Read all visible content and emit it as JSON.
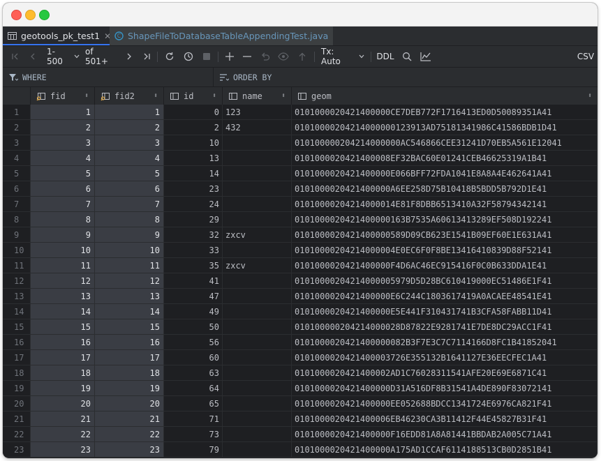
{
  "tabs": [
    {
      "label": "geotools_pk_test1",
      "active": true
    },
    {
      "label": "ShapeFileToDatabaseTableAppendingTest.java",
      "active": false
    }
  ],
  "toolbar": {
    "range": "1-500",
    "total": "of 501+",
    "tx": "Tx: Auto",
    "ddl": "DDL",
    "csv": "CSV"
  },
  "filter": {
    "where": "WHERE",
    "order_by": "ORDER BY"
  },
  "columns": [
    {
      "key": "fid",
      "label": "fid",
      "icon": "key-column-icon"
    },
    {
      "key": "fid2",
      "label": "fid2",
      "icon": "key-column-icon"
    },
    {
      "key": "id",
      "label": "id",
      "icon": "column-icon"
    },
    {
      "key": "name",
      "label": "name",
      "icon": "column-icon"
    },
    {
      "key": "geom",
      "label": "geom",
      "icon": "column-icon"
    }
  ],
  "rows": [
    {
      "n": "1",
      "fid": "1",
      "fid2": "1",
      "id": "0",
      "name": "123",
      "geom": "0101000020421400000CE7DEB772F1716413ED0D50089351A41"
    },
    {
      "n": "2",
      "fid": "2",
      "fid2": "2",
      "id": "2",
      "name": "432",
      "geom": "01010000204214000000123913AD75181341986C41586BDB1D41"
    },
    {
      "n": "3",
      "fid": "3",
      "fid2": "3",
      "id": "10",
      "name": "",
      "geom": "010100000204214000000AC546866CEE31241D70EB5A561E12041"
    },
    {
      "n": "4",
      "fid": "4",
      "fid2": "4",
      "id": "13",
      "name": "",
      "geom": "0101000020421400008EF32BAC60E01241CEB46625319A1B41"
    },
    {
      "n": "5",
      "fid": "5",
      "fid2": "5",
      "id": "14",
      "name": "",
      "geom": "0101000020421400000E066BFF72FDA1041E8A8A4E462641A41"
    },
    {
      "n": "6",
      "fid": "6",
      "fid2": "6",
      "id": "23",
      "name": "",
      "geom": "0101000020421400000A6EE258D75B10418B5BDD5B792D1E41"
    },
    {
      "n": "7",
      "fid": "7",
      "fid2": "7",
      "id": "24",
      "name": "",
      "geom": "01010000204214000014E81F8DBB6513410A32F58794342141"
    },
    {
      "n": "8",
      "fid": "8",
      "fid2": "8",
      "id": "29",
      "name": "",
      "geom": "0101000020421400000163B7535A60613413289EF508D192241"
    },
    {
      "n": "9",
      "fid": "9",
      "fid2": "9",
      "id": "32",
      "name": "zxcv",
      "geom": "0101000020421400000589D09CB623E1541B09EF60E1E631A41"
    },
    {
      "n": "10",
      "fid": "10",
      "fid2": "10",
      "id": "33",
      "name": "",
      "geom": "01010000204214000004E0EC6F0F8BE13416410839D88F52141"
    },
    {
      "n": "11",
      "fid": "11",
      "fid2": "11",
      "id": "35",
      "name": "zxcv",
      "geom": "0101000020421400000F4D6AC46EC915416F0C0B633DDA1E41"
    },
    {
      "n": "12",
      "fid": "12",
      "fid2": "12",
      "id": "41",
      "name": "",
      "geom": "01010000204214000005979D5D28BC610419000EC51486E1F41"
    },
    {
      "n": "13",
      "fid": "13",
      "fid2": "13",
      "id": "47",
      "name": "",
      "geom": "0101000020421400000E6C244C1803617419A0ACAEE48541E41"
    },
    {
      "n": "14",
      "fid": "14",
      "fid2": "14",
      "id": "49",
      "name": "",
      "geom": "0101000020421400000E5E441F310431741B3CFA58FABB11D41"
    },
    {
      "n": "15",
      "fid": "15",
      "fid2": "15",
      "id": "50",
      "name": "",
      "geom": "010100000204214000028D87822E9281741E7DE8DC29ACC1F41"
    },
    {
      "n": "16",
      "fid": "16",
      "fid2": "16",
      "id": "56",
      "name": "",
      "geom": "0101000020421400000082B3F7E3C7C7114166D8FC1B41852041"
    },
    {
      "n": "17",
      "fid": "17",
      "fid2": "17",
      "id": "60",
      "name": "",
      "geom": "0101000020421400003726E355132B1641127E36EECFEC1A41"
    },
    {
      "n": "18",
      "fid": "18",
      "fid2": "18",
      "id": "63",
      "name": "",
      "geom": "0101000020421400002AD1C76028311541AFE20E69E6871C41"
    },
    {
      "n": "19",
      "fid": "19",
      "fid2": "19",
      "id": "64",
      "name": "",
      "geom": "0101000020421400000D31A516DF8B31541A4DE890F83072141"
    },
    {
      "n": "20",
      "fid": "20",
      "fid2": "20",
      "id": "65",
      "name": "",
      "geom": "0101000020421400000EE052688BDCC1341724E6976CA821F41"
    },
    {
      "n": "21",
      "fid": "21",
      "fid2": "21",
      "id": "71",
      "name": "",
      "geom": "0101000020421400006EB46230CA3B11412F44E45827B31F41"
    },
    {
      "n": "22",
      "fid": "22",
      "fid2": "22",
      "id": "73",
      "name": "",
      "geom": "0101000020421400000F16EDD81A8A81441BBDAB2A005C71A41"
    },
    {
      "n": "23",
      "fid": "23",
      "fid2": "23",
      "id": "79",
      "name": "",
      "geom": "0101000020421400000A175AD1CCAF6114188513CB0D2851B41"
    }
  ]
}
